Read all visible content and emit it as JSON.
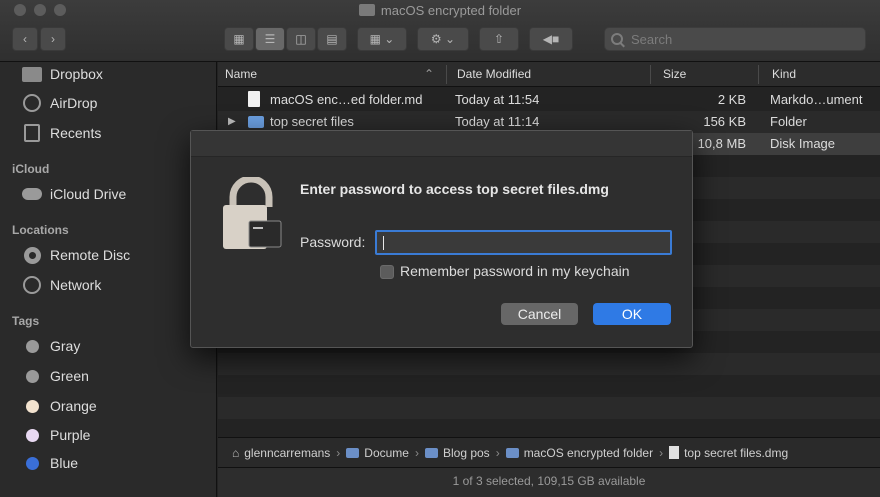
{
  "window": {
    "title": "macOS encrypted folder"
  },
  "toolbar": {
    "search_placeholder": "Search"
  },
  "sidebar": {
    "favorites": [
      {
        "label": "Dropbox",
        "icon": "dropbox-folder-icon"
      },
      {
        "label": "AirDrop",
        "icon": "airdrop-icon"
      },
      {
        "label": "Recents",
        "icon": "recents-icon"
      }
    ],
    "icloud_header": "iCloud",
    "icloud": [
      {
        "label": "iCloud Drive",
        "icon": "cloud-icon"
      }
    ],
    "locations_header": "Locations",
    "locations": [
      {
        "label": "Remote Disc",
        "icon": "disc-icon"
      },
      {
        "label": "Network",
        "icon": "network-icon"
      }
    ],
    "tags_header": "Tags",
    "tags": [
      {
        "label": "Gray",
        "color": "#9a9a9a"
      },
      {
        "label": "Green",
        "color": "#9a9a9a"
      },
      {
        "label": "Orange",
        "color": "#f3e3cf"
      },
      {
        "label": "Purple",
        "color": "#e9d9f2"
      },
      {
        "label": "Blue",
        "color": "#3a6fd8"
      }
    ]
  },
  "list": {
    "columns": {
      "name": "Name",
      "date": "Date Modified",
      "size": "Size",
      "kind": "Kind"
    },
    "rows": [
      {
        "name": "macOS enc…ed folder.md",
        "date": "Today at 11:54",
        "size": "2 KB",
        "kind": "Markdo…ument"
      },
      {
        "name": "top secret files",
        "date": "Today at 11:14",
        "size": "156 KB",
        "kind": "Folder"
      },
      {
        "name": "",
        "date": "",
        "size": "10,8 MB",
        "kind": "Disk Image"
      }
    ]
  },
  "pathbar": {
    "items": [
      "glenncarremans",
      "Docume",
      "Blog pos",
      "macOS encrypted folder",
      "top secret files.dmg"
    ]
  },
  "status": {
    "text": "1 of 3 selected, 109,15 GB available"
  },
  "dialog": {
    "title": "Enter password to access top secret files.dmg",
    "password_label": "Password:",
    "password_value": "",
    "remember_label": "Remember password in my keychain",
    "cancel_label": "Cancel",
    "ok_label": "OK"
  },
  "colors": {
    "accent": "#2f7ae5",
    "focus_ring": "#3a7bd5"
  }
}
